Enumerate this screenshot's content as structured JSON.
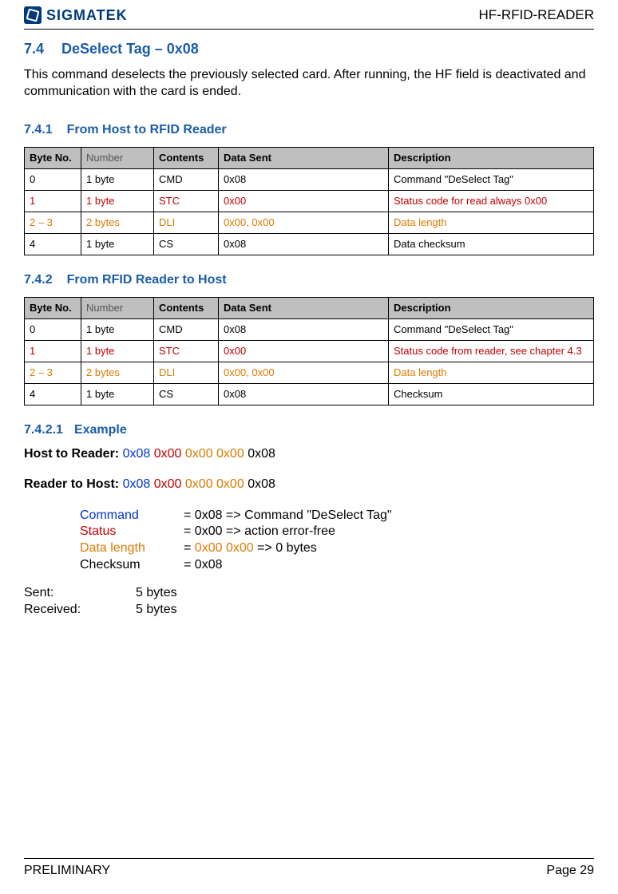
{
  "header": {
    "logo_text": "SIGMATEK",
    "doc_id": "HF-RFID-READER"
  },
  "section": {
    "num": "7.4",
    "title": "DeSelect Tag – 0x08",
    "intro": "This command deselects the previously selected card. After running, the HF field is deactivated and communication with the card is ended."
  },
  "sub1": {
    "num": "7.4.1",
    "title": "From Host to RFID Reader",
    "headers": [
      "Byte No.",
      "Number",
      "Contents",
      "Data Sent",
      "Description"
    ],
    "rows": [
      {
        "cls": "",
        "c": [
          "0",
          "1 byte",
          "CMD",
          "0x08",
          "Command \"DeSelect Tag\""
        ]
      },
      {
        "cls": "red",
        "c": [
          "1",
          "1 byte",
          "STC",
          "0x00",
          "Status code for read always 0x00"
        ]
      },
      {
        "cls": "orange",
        "c": [
          "2 – 3",
          "2 bytes",
          "DLI",
          "0x00, 0x00",
          "Data length"
        ]
      },
      {
        "cls": "",
        "c": [
          "4",
          "1 byte",
          "CS",
          "0x08",
          "Data checksum"
        ]
      }
    ]
  },
  "sub2": {
    "num": "7.4.2",
    "title": "From RFID Reader to Host",
    "headers": [
      "Byte No.",
      "Number",
      "Contents",
      "Data Sent",
      "Description"
    ],
    "rows": [
      {
        "cls": "",
        "c": [
          "0",
          "1 byte",
          "CMD",
          "0x08",
          "Command \"DeSelect Tag\""
        ]
      },
      {
        "cls": "red",
        "c": [
          "1",
          "1 byte",
          "STC",
          "0x00",
          "Status code from reader, see chapter 4.3"
        ]
      },
      {
        "cls": "orange",
        "c": [
          "2 – 3",
          "2 bytes",
          "DLI",
          "0x00, 0x00",
          "Data length"
        ]
      },
      {
        "cls": "",
        "c": [
          "4",
          "1 byte",
          "CS",
          "0x08",
          "Checksum"
        ]
      }
    ]
  },
  "example": {
    "num": "7.4.2.1",
    "title": "Example",
    "host_label": "Host to Reader:",
    "host_parts": {
      "p1": "0x08",
      "p2": "0x00",
      "p3": "0x00 0x00",
      "p4": "0x08"
    },
    "reader_label": "Reader to Host:",
    "reader_parts": {
      "p1": "0x08",
      "p2": "0x00",
      "p3": "0x00 0x00",
      "p4": "0x08"
    },
    "legend": [
      {
        "key": "Command",
        "cls": "blue",
        "val": "= 0x08 => Command \"DeSelect Tag\""
      },
      {
        "key": "Status",
        "cls": "red",
        "val": "= 0x00 => action error-free"
      },
      {
        "key": "Data length",
        "cls": "orange",
        "val_prefix": "=  ",
        "val_colored": "0x00 0x00",
        "val_suffix": " => 0 bytes"
      },
      {
        "key": "Checksum",
        "cls": "",
        "val": "= 0x08"
      }
    ],
    "summary": [
      {
        "k": "Sent:",
        "v": "5 bytes"
      },
      {
        "k": "Received:",
        "v": "5 bytes"
      }
    ]
  },
  "footer": {
    "left": "PRELIMINARY",
    "right": "Page 29"
  }
}
